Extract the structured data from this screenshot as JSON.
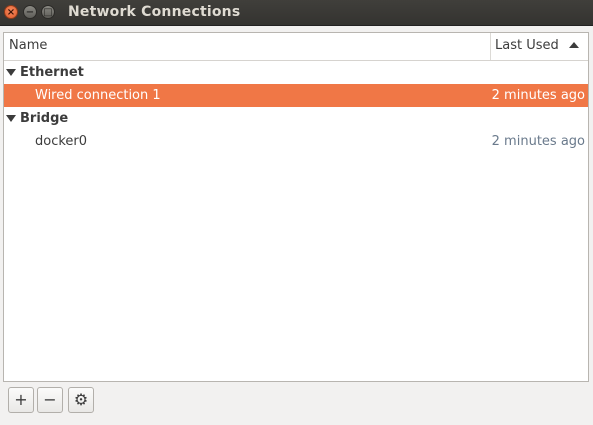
{
  "window": {
    "title": "Network Connections",
    "buttons": {
      "close": "×",
      "minimize": "−",
      "maximize": "□"
    }
  },
  "table": {
    "columns": {
      "name": "Name",
      "last_used": "Last Used",
      "sort": "ascending"
    },
    "groups": [
      {
        "label": "Ethernet",
        "connections": [
          {
            "name": "Wired connection 1",
            "last_used": "2 minutes ago",
            "selected": true
          }
        ]
      },
      {
        "label": "Bridge",
        "connections": [
          {
            "name": "docker0",
            "last_used": "2 minutes ago",
            "selected": false
          }
        ]
      }
    ]
  },
  "toolbar": {
    "add": "+",
    "remove": "−",
    "settings": "⚙"
  },
  "colors": {
    "selection": "#f07746",
    "titlebar": "#3c3b37",
    "time_text": "#6a7a8c"
  }
}
